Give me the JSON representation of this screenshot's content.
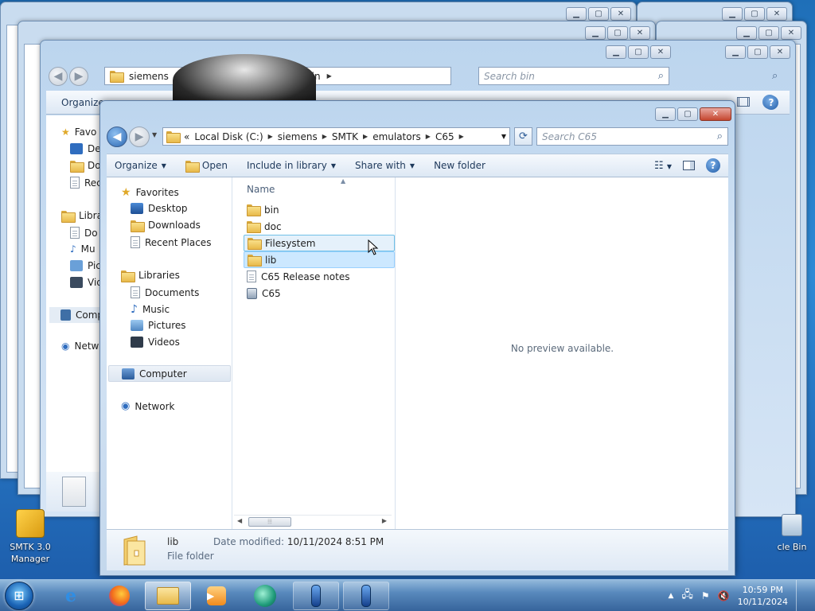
{
  "background_windows": [
    {
      "id": "w1",
      "breadcrumb": []
    },
    {
      "id": "w2",
      "breadcrumb": []
    },
    {
      "id": "w3",
      "breadcrumb": [
        "siemens",
        "bin"
      ],
      "search_placeholder": "Search bin",
      "organize": "Organize",
      "nav_items": [
        "Favo",
        "Des",
        "Do",
        "Rec",
        "Libra",
        "Do",
        "Mu",
        "Pic",
        "Vid",
        "Comp",
        "Netw"
      ]
    }
  ],
  "main_window": {
    "caption": {
      "minimize": "▁",
      "maximize": "▢",
      "close": "✕"
    },
    "address": {
      "overflow": "«",
      "crumbs": [
        "Local Disk (C:)",
        "siemens",
        "SMTK",
        "emulators",
        "C65"
      ]
    },
    "search": {
      "placeholder": "Search C65"
    },
    "command_bar": {
      "organize": "Organize",
      "open": "Open",
      "include_in_library": "Include in library",
      "share_with": "Share with",
      "new_folder": "New folder"
    },
    "nav_pane": {
      "favorites": {
        "label": "Favorites",
        "items": [
          "Desktop",
          "Downloads",
          "Recent Places"
        ]
      },
      "libraries": {
        "label": "Libraries",
        "items": [
          "Documents",
          "Music",
          "Pictures",
          "Videos"
        ]
      },
      "computer": "Computer",
      "network": "Network"
    },
    "file_list": {
      "column_name": "Name",
      "items": [
        {
          "name": "bin",
          "type": "folder"
        },
        {
          "name": "doc",
          "type": "folder"
        },
        {
          "name": "Filesystem",
          "type": "folder"
        },
        {
          "name": "lib",
          "type": "folder"
        },
        {
          "name": "C65 Release notes",
          "type": "document"
        },
        {
          "name": "C65",
          "type": "application"
        }
      ]
    },
    "preview": {
      "text": "No preview available."
    },
    "details": {
      "name": "lib",
      "type": "File folder",
      "modified_label": "Date modified:",
      "modified_value": "10/11/2024 8:51 PM"
    }
  },
  "desktop": {
    "icons": [
      {
        "label_line1": "SMTK 3.0",
        "label_line2": "Manager"
      },
      {
        "label_line1": "cle Bin"
      }
    ]
  },
  "taskbar": {
    "start_icon": "windows-orb-icon",
    "items": [
      "internet-explorer-icon",
      "firefox-icon",
      "explorer-icon",
      "media-player-icon",
      "app-icon",
      "phone-emulator-icon",
      "phone-emulator-icon"
    ],
    "clock_time": "10:59 PM",
    "clock_date": "10/11/2024"
  }
}
